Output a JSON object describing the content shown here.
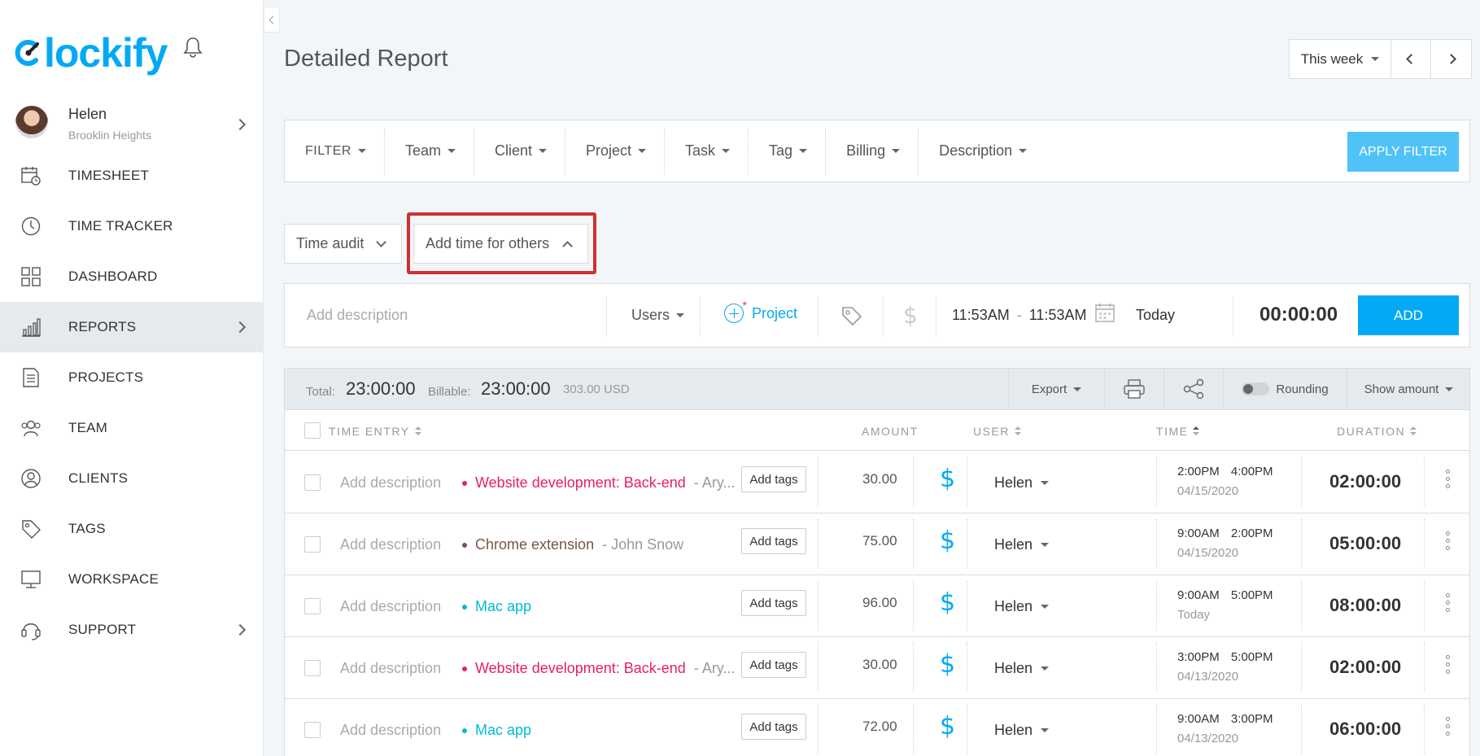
{
  "brand": {
    "name": "lockify",
    "accent": "#03a9f4"
  },
  "profile": {
    "name": "Helen",
    "workspace": "Brooklin Heights"
  },
  "nav": [
    {
      "label": "TIMESHEET",
      "icon": "timesheet-icon"
    },
    {
      "label": "TIME TRACKER",
      "icon": "clock-icon"
    },
    {
      "label": "DASHBOARD",
      "icon": "dashboard-icon"
    },
    {
      "label": "REPORTS",
      "icon": "reports-icon",
      "active": true
    },
    {
      "label": "PROJECTS",
      "icon": "projects-icon"
    },
    {
      "label": "TEAM",
      "icon": "team-icon"
    },
    {
      "label": "CLIENTS",
      "icon": "clients-icon"
    },
    {
      "label": "TAGS",
      "icon": "tag-icon"
    },
    {
      "label": "WORKSPACE",
      "icon": "workspace-icon"
    },
    {
      "label": "SUPPORT",
      "icon": "support-icon"
    }
  ],
  "header": {
    "title": "Detailed Report",
    "range": "This week"
  },
  "filters": {
    "label": "FILTER",
    "items": [
      "Team",
      "Client",
      "Project",
      "Task",
      "Tag",
      "Billing",
      "Description"
    ],
    "apply": "APPLY FILTER"
  },
  "mode": {
    "audit": "Time audit",
    "add_others": "Add time for others"
  },
  "entry": {
    "placeholder": "Add description",
    "users": "Users",
    "project": "Project",
    "start": "11:53AM",
    "sep": "-",
    "end": "11:53AM",
    "date": "Today",
    "duration": "00:00:00",
    "add": "ADD"
  },
  "summary": {
    "total_label": "Total:",
    "total": "23:00:00",
    "billable_label": "Billable:",
    "billable": "23:00:00",
    "amount": "303.00 USD",
    "export": "Export",
    "rounding": "Rounding",
    "show_amount": "Show amount"
  },
  "columns": {
    "entry": "TIME ENTRY",
    "amount": "AMOUNT",
    "user": "USER",
    "time": "TIME",
    "duration": "DURATION"
  },
  "rows": [
    {
      "desc": "Add description",
      "project": "Website development: Back-end",
      "color": "#e91e63",
      "client": "- Ary...",
      "tags": "Add tags",
      "amount": "30.00",
      "user": "Helen",
      "time": "2:00PM 4:00PM",
      "date": "04/15/2020",
      "duration": "02:00:00"
    },
    {
      "desc": "Add description",
      "project": "Chrome extension",
      "color": "#795548",
      "client": "- John Snow",
      "tags": "Add tags",
      "amount": "75.00",
      "user": "Helen",
      "time": "9:00AM 2:00PM",
      "date": "04/15/2020",
      "duration": "05:00:00"
    },
    {
      "desc": "Add description",
      "project": "Mac app",
      "color": "#00bcd4",
      "client": "",
      "tags": "Add tags",
      "amount": "96.00",
      "user": "Helen",
      "time": "9:00AM 5:00PM",
      "date": "Today",
      "duration": "08:00:00"
    },
    {
      "desc": "Add description",
      "project": "Website development: Back-end",
      "color": "#e91e63",
      "client": "- Ary...",
      "tags": "Add tags",
      "amount": "30.00",
      "user": "Helen",
      "time": "3:00PM 5:00PM",
      "date": "04/13/2020",
      "duration": "02:00:00"
    },
    {
      "desc": "Add description",
      "project": "Mac app",
      "color": "#00bcd4",
      "client": "",
      "tags": "Add tags",
      "amount": "72.00",
      "user": "Helen",
      "time": "9:00AM 3:00PM",
      "date": "04/13/2020",
      "duration": "06:00:00"
    }
  ]
}
